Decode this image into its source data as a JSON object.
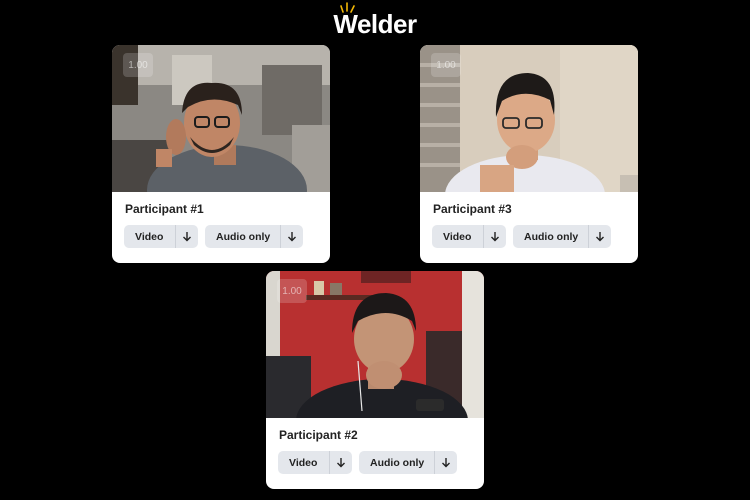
{
  "app": {
    "name": "Welder"
  },
  "participants": [
    {
      "name": "Participant #1",
      "zoom": "1.00",
      "video_label": "Video",
      "audio_label": "Audio only",
      "download_icon": "arrow-down-icon"
    },
    {
      "name": "Participant #3",
      "zoom": "1.00",
      "video_label": "Video",
      "audio_label": "Audio only",
      "download_icon": "arrow-down-icon"
    },
    {
      "name": "Participant #2",
      "zoom": "1.00",
      "video_label": "Video",
      "audio_label": "Audio only",
      "download_icon": "arrow-down-icon"
    }
  ],
  "colors": {
    "background": "#000000",
    "card": "#ffffff",
    "button": "#e4e7ec",
    "logo_accent": "#f2b705"
  }
}
